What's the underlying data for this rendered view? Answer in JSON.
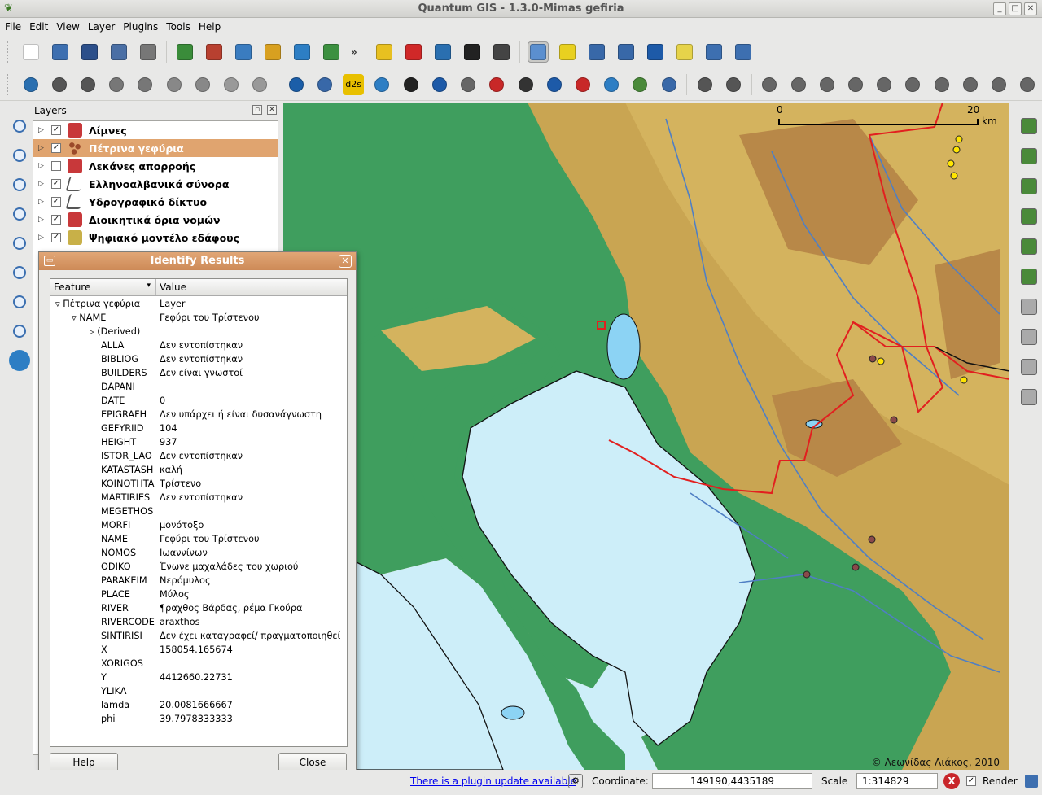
{
  "window": {
    "title": "Quantum GIS - 1.3.0-Mimas gefiria",
    "controls": [
      "_",
      "□",
      "✕"
    ]
  },
  "menu": [
    "File",
    "Edit",
    "View",
    "Layer",
    "Plugins",
    "Tools",
    "Help"
  ],
  "toolbar1": {
    "icons": [
      "new-project-icon",
      "open-project-icon",
      "save-project-icon",
      "save-as-icon",
      "print-icon",
      "add-vector-icon",
      "add-raster-icon",
      "add-postgis-icon",
      "add-spatialite-icon",
      "add-wms-icon",
      "new-vector-icon",
      "more-icon",
      "capture-point-icon",
      "delete-icon",
      "ring-icon",
      "view-icon",
      "hide-icon",
      "identify-icon",
      "select-icon",
      "attribute-table-icon",
      "measure-icon",
      "measure-area-icon",
      "map-tips-icon",
      "bookmark-icon",
      "home-icon"
    ],
    "more": "»",
    "icon_colors": [
      "#ffffff",
      "#3d6fb0",
      "#2c4f8a",
      "#4a6fa5",
      "#777777",
      "#3a8c3a",
      "#b84030",
      "#3a7cc0",
      "#d8a020",
      "#2d7ec4",
      "#3c9040",
      "#333333",
      "#e8c020",
      "#d02828",
      "#2a6fb0",
      "#222222",
      "#444444",
      "#5b8fcf",
      "#e8d020",
      "#3868a8",
      "#3868a8",
      "#1d5aa8",
      "#e6d34a",
      "#3d6fb0",
      "#3d6fb0"
    ]
  },
  "toolbar2": {
    "icons": [
      "digitize-icon",
      "move-feature-icon",
      "move-vertex-icon",
      "add-vertex-icon",
      "delete-vertex-icon",
      "delete-selected-icon",
      "cut-icon",
      "copy-icon",
      "paste-icon",
      "copyright-icon",
      "georeferencer-icon",
      "d2s-icon",
      "globe-icon",
      "profile-icon",
      "north-arrow-icon",
      "gdal-icon",
      "pdf-icon",
      "scale-icon",
      "gps-icon",
      "image-icon",
      "compass-icon",
      "plugin-icon",
      "zoom-icon",
      "undo-icon",
      "redo-icon",
      "simplify-icon",
      "add-ring-icon",
      "add-part-icon",
      "delete-ring-icon",
      "delete-part-icon",
      "reshape-icon",
      "split-icon",
      "merge-icon",
      "rotate-icon",
      "node-tool-icon"
    ],
    "d2s_label": "d2s",
    "icon_colors": [
      "#2a6fb0",
      "#555555",
      "#555555",
      "#777777",
      "#777777",
      "#888888",
      "#888888",
      "#999999",
      "#999999",
      "#1b5ea8",
      "#3868a8",
      "#e8c000",
      "#2d7ec4",
      "#222222",
      "#1d5aa8",
      "#666666",
      "#c82828",
      "#333333",
      "#1d5aa8",
      "#c82828",
      "#2d7ec4",
      "#4a8a3a",
      "#3868a8",
      "#555555",
      "#555555",
      "#666666",
      "#666666",
      "#666666",
      "#666666",
      "#666666",
      "#666666",
      "#666666",
      "#666666",
      "#666666",
      "#666666"
    ]
  },
  "left_tools": [
    "pan-icon",
    "zoom-in-icon",
    "zoom-out-icon",
    "zoom-full-icon",
    "zoom-layer-icon",
    "zoom-selection-icon",
    "zoom-last-icon",
    "zoom-next-icon",
    "refresh-icon"
  ],
  "right_tools": [
    "add-vector-layer-icon",
    "add-favourite-icon",
    "remove-layer-icon",
    "add-wms-icon",
    "add-postgis-icon",
    "raster-icon",
    "edit-icon",
    "settings-icon",
    "legend-icon",
    "overview-icon"
  ],
  "layers_panel": {
    "title": "Layers",
    "layers": [
      {
        "name": "Λίμνες",
        "checked": true,
        "selected": false,
        "icon": "polygon-icon",
        "color": "#c8383a"
      },
      {
        "name": "Πέτρινα γεφύρια",
        "checked": true,
        "selected": true,
        "icon": "point-icon",
        "color": "#9b4a2a"
      },
      {
        "name": "Λεκάνες απορροής",
        "checked": false,
        "selected": false,
        "icon": "polygon-icon",
        "color": "#c8383a"
      },
      {
        "name": "Ελληνοαλβανικά σύνορα",
        "checked": true,
        "selected": false,
        "icon": "line-icon",
        "color": "#555555"
      },
      {
        "name": "Υδρογραφικό δίκτυο",
        "checked": true,
        "selected": false,
        "icon": "line-icon",
        "color": "#555555"
      },
      {
        "name": "Διοικητικά όρια νομών",
        "checked": true,
        "selected": false,
        "icon": "polygon-icon",
        "color": "#c8383a"
      },
      {
        "name": "Ψηφιακό μοντέλο εδάφους",
        "checked": true,
        "selected": false,
        "icon": "raster-icon",
        "color": "#c8b048"
      }
    ]
  },
  "identify_dialog": {
    "title": "Identify Results",
    "columns": [
      "Feature",
      "Value"
    ],
    "layer": {
      "name": "Πέτρινα γεφύρια",
      "value": "Layer"
    },
    "feature": {
      "key": "NAME",
      "value": "Γεφύρι του Τρίστενου"
    },
    "derived": "(Derived)",
    "attributes": [
      {
        "k": "ALLA",
        "v": "Δεν εντοπίστηκαν"
      },
      {
        "k": "BIBLIOG",
        "v": "Δεν εντοπίστηκαν"
      },
      {
        "k": "BUILDERS",
        "v": "Δεν είναι γνωστοί"
      },
      {
        "k": "DAPANI",
        "v": ""
      },
      {
        "k": "DATE",
        "v": "0"
      },
      {
        "k": "EPIGRAFH",
        "v": "Δεν υπάρχει ή είναι δυσανάγνωστη"
      },
      {
        "k": "GEFYRIID",
        "v": "104"
      },
      {
        "k": "HEIGHT",
        "v": "937"
      },
      {
        "k": "ISTOR_LAO",
        "v": "Δεν εντοπίστηκαν"
      },
      {
        "k": "KATASTASH",
        "v": "καλή"
      },
      {
        "k": "KOINOTHTA",
        "v": "Τρίστενο"
      },
      {
        "k": "MARTIRIES",
        "v": "Δεν εντοπίστηκαν"
      },
      {
        "k": "MEGETHOS",
        "v": ""
      },
      {
        "k": "MORFI",
        "v": "μονότοξο"
      },
      {
        "k": "NAME",
        "v": "Γεφύρι του Τρίστενου"
      },
      {
        "k": "NOMOS",
        "v": "Ιωαννίνων"
      },
      {
        "k": "ODIKO",
        "v": "Ένωνε μαχαλάδες του χωριού"
      },
      {
        "k": "PARAKEIM",
        "v": "Νερόμυλος"
      },
      {
        "k": "PLACE",
        "v": "Μύλος"
      },
      {
        "k": "RIVER",
        "v": "¶ραχθος Βάρδας, ρέμα Γκούρα"
      },
      {
        "k": "RIVERCODE",
        "v": "araxthos"
      },
      {
        "k": "SINTIRISI",
        "v": "Δεν έχει καταγραφεί/ πραγματοποιηθεί"
      },
      {
        "k": "X",
        "v": "158054.165674"
      },
      {
        "k": "XORIGOS",
        "v": ""
      },
      {
        "k": "Y",
        "v": "4412660.22731"
      },
      {
        "k": "YLIKA",
        "v": ""
      },
      {
        "k": "lamda",
        "v": "20.0081666667"
      },
      {
        "k": "phi",
        "v": "39.7978333333"
      }
    ],
    "help_label": "Help",
    "close_label": "Close"
  },
  "map": {
    "scale_start": "0",
    "scale_end": "20",
    "scale_unit": "km",
    "copyright": "© Λεωνίδας Λιάκος, 2010",
    "colors": {
      "sea": "#cdeef9",
      "lowland": "#3a9a5c",
      "midland": "#d2a443",
      "highland": "#b88a4a",
      "border": "#e21f1f",
      "river": "#4f7fc4",
      "lake": "#8cd3f4"
    }
  },
  "statusbar": {
    "plugin_notice": "There is a plugin update available",
    "coordinate_label": "Coordinate:",
    "coordinate": "149190,4435189",
    "scale_label": "Scale",
    "scale": "1:314829",
    "render_label": "Render",
    "render_checked": true
  }
}
